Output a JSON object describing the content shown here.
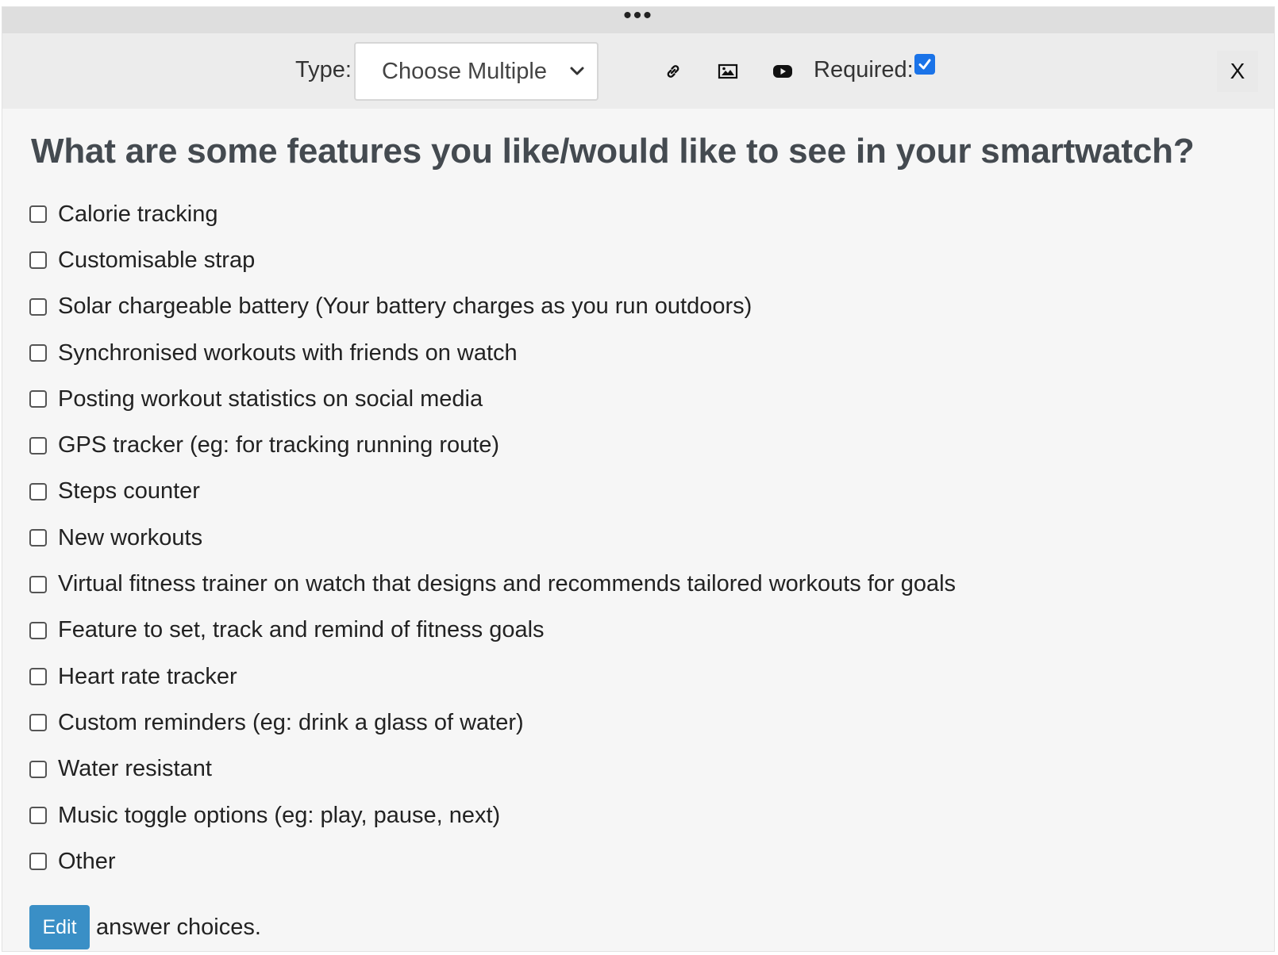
{
  "drag_handle": {
    "glyph": "•••"
  },
  "toolbar": {
    "type_label": "Type:",
    "type_select_value": "Choose Multiple",
    "icons": {
      "link": "link-icon",
      "image": "image-icon",
      "video": "youtube-icon",
      "close": "close-icon"
    },
    "required_label": "Required:",
    "required_checked": true,
    "close_label": "X"
  },
  "question": {
    "title": "What are some features you like/would like to see in your smartwatch?",
    "choices": [
      "Calorie tracking",
      "Customisable strap",
      "Solar chargeable battery (Your battery charges as you run outdoors)",
      "Synchronised workouts with friends on watch",
      "Posting workout statistics on social media",
      "GPS tracker (eg: for tracking running route)",
      "Steps counter",
      "New workouts",
      "Virtual fitness trainer on watch that designs and recommends tailored workouts for goals",
      "Feature to set, track and remind of fitness goals",
      "Heart rate tracker",
      "Custom reminders (eg: drink a glass of water)",
      "Water resistant",
      "Music toggle options (eg: play, pause, next)",
      "Other"
    ]
  },
  "footer": {
    "edit_label": "Edit",
    "text": "answer choices."
  },
  "colors": {
    "accent": "#1a73e8",
    "edit_button": "#3a8fc6",
    "title": "#444a50",
    "panel_bg": "#f6f6f6",
    "toolbar_bg": "#ececec",
    "drag_bar_bg": "#dedede"
  }
}
